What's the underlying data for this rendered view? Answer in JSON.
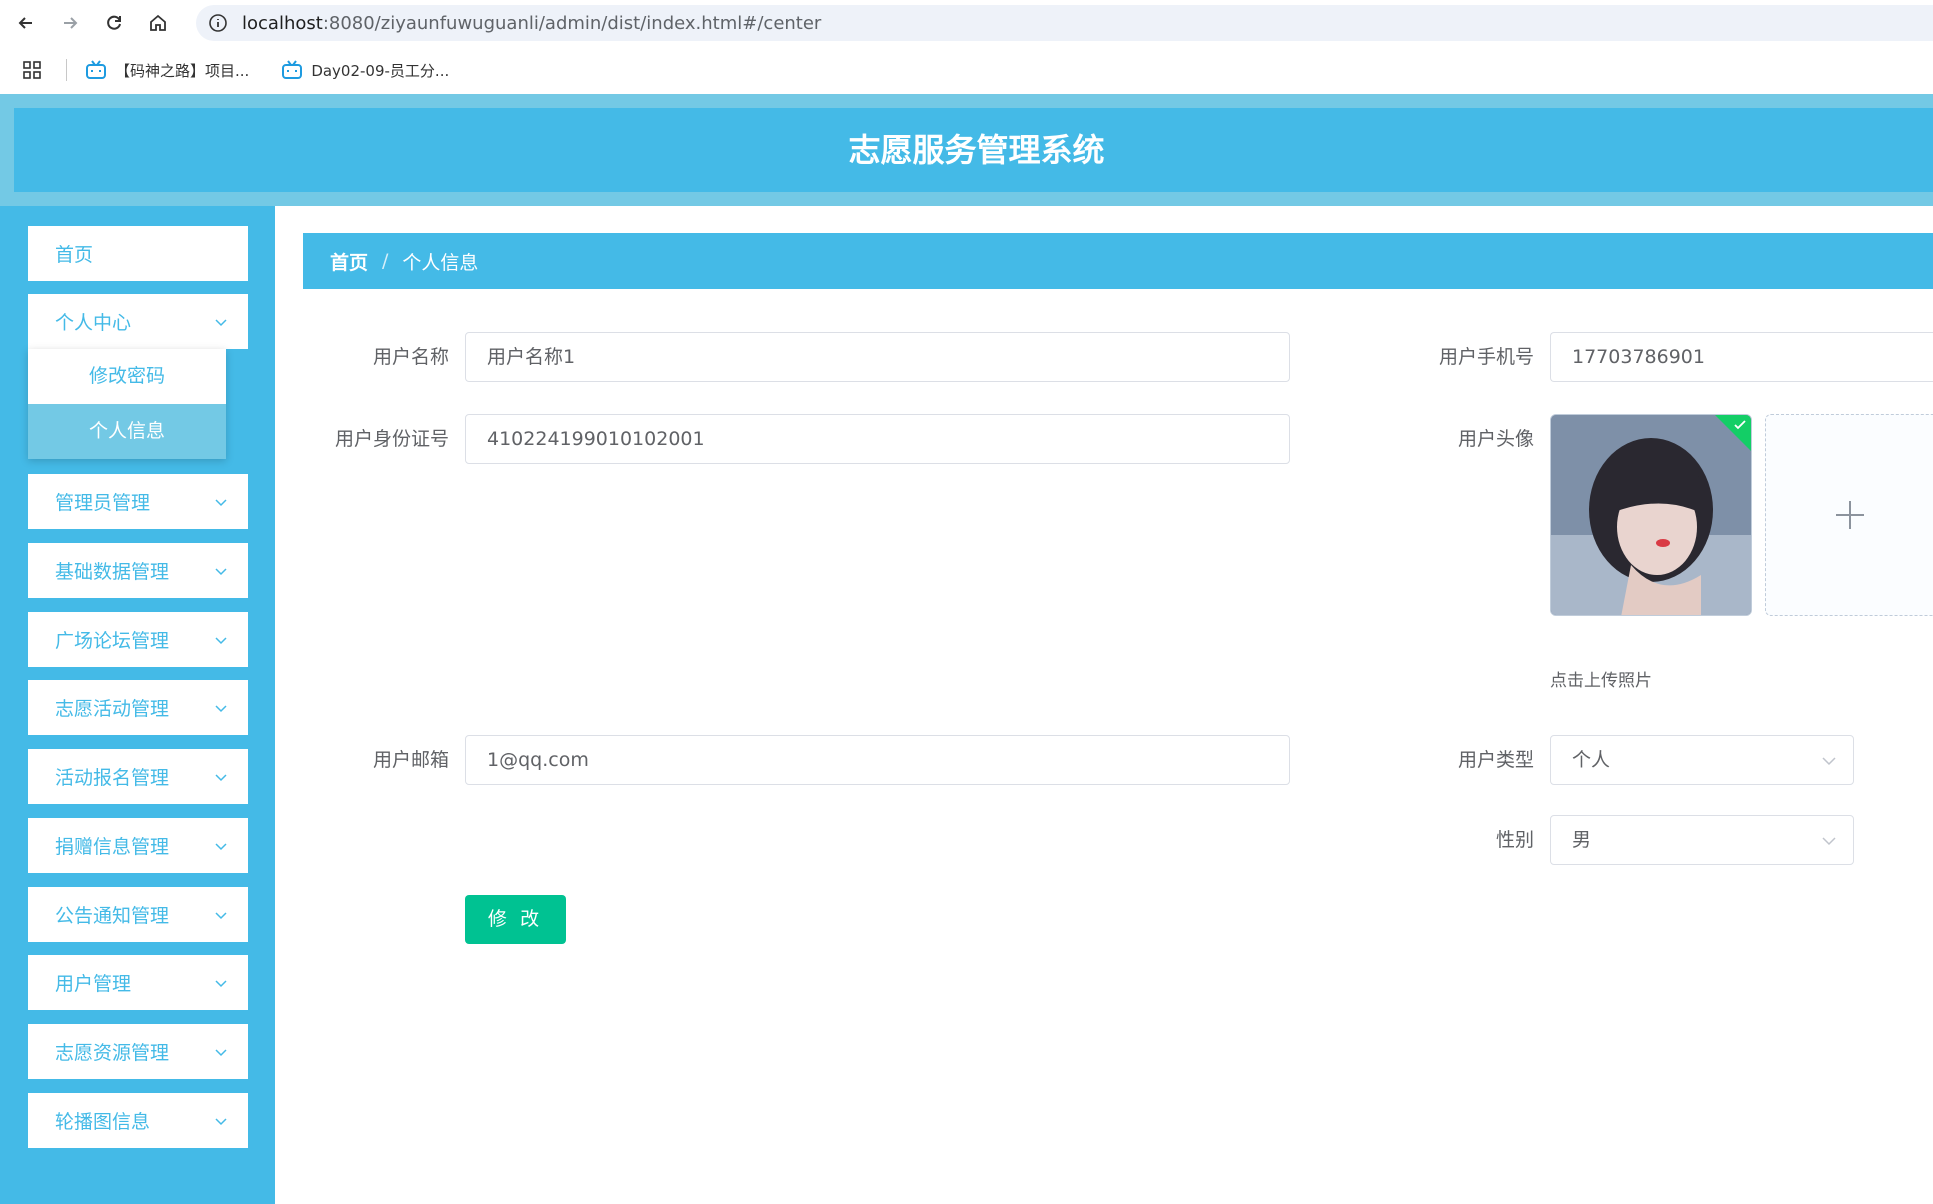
{
  "browser": {
    "url_host": "localhost",
    "url_rest": ":8080/ziyaunfuwuguanli/admin/dist/index.html#/center",
    "bookmarks": [
      {
        "label": "【码神之路】项目..."
      },
      {
        "label": "Day02-09-员工分..."
      }
    ]
  },
  "header": {
    "title": "志愿服务管理系统"
  },
  "sidebar": {
    "items": [
      {
        "label": "首页"
      },
      {
        "label": "个人中心"
      },
      {
        "label": "管理员管理"
      },
      {
        "label": "基础数据管理"
      },
      {
        "label": "广场论坛管理"
      },
      {
        "label": "志愿活动管理"
      },
      {
        "label": "活动报名管理"
      },
      {
        "label": "捐赠信息管理"
      },
      {
        "label": "公告通知管理"
      },
      {
        "label": "用户管理"
      },
      {
        "label": "志愿资源管理"
      },
      {
        "label": "轮播图信息"
      }
    ],
    "submenu": [
      {
        "label": "修改密码"
      },
      {
        "label": "个人信息"
      }
    ]
  },
  "breadcrumb": {
    "home": "首页",
    "separator": "/",
    "current": "个人信息"
  },
  "form": {
    "username": {
      "label": "用户名称",
      "value": "用户名称1"
    },
    "phone": {
      "label": "用户手机号",
      "value": "17703786901"
    },
    "id_number": {
      "label": "用户身份证号",
      "value": "410224199010102001"
    },
    "avatar": {
      "label": "用户头像",
      "tip": "点击上传照片"
    },
    "email": {
      "label": "用户邮箱",
      "value": "1@qq.com"
    },
    "user_type": {
      "label": "用户类型",
      "value": "个人"
    },
    "gender": {
      "label": "性别",
      "value": "男"
    },
    "submit_label": "修 改"
  },
  "colors": {
    "primary": "#44bae7",
    "header_outer": "#73c9e5",
    "submenu_active": "#73c9e5",
    "button": "#00c292",
    "success_badge": "#13ce66"
  }
}
